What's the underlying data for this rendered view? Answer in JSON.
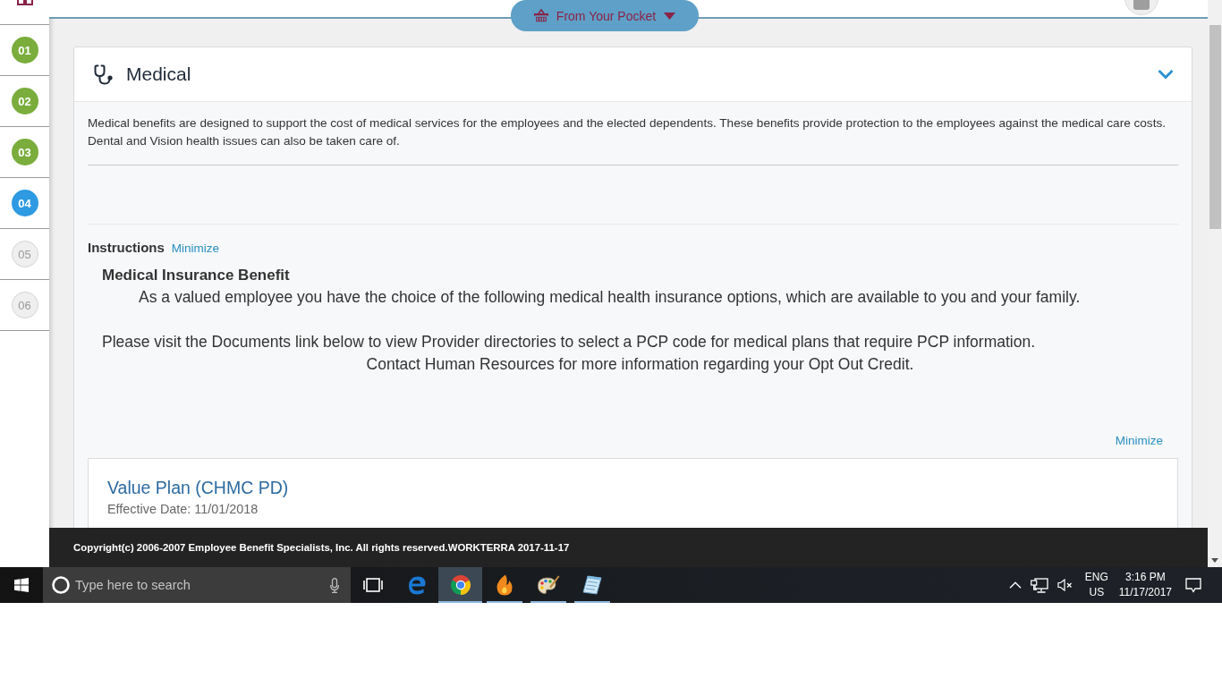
{
  "sidebar": {
    "steps": [
      {
        "label": "01",
        "completed": true,
        "selected": false
      },
      {
        "label": "02",
        "completed": true,
        "selected": false
      },
      {
        "label": "03",
        "completed": true,
        "selected": false
      },
      {
        "label": "04",
        "completed": false,
        "selected": true
      },
      {
        "label": "05",
        "completed": false,
        "selected": false
      },
      {
        "label": "06",
        "completed": false,
        "selected": false
      }
    ]
  },
  "header": {
    "pocket_menu": {
      "label": "From Your Pocket"
    }
  },
  "section": {
    "title": "Medical",
    "description": "Medical benefits are designed to support the cost of medical services for the employees and the elected dependents. These benefits provide protection to the employees against the medical care costs. Dental and Vision health issues can also be taken care of.",
    "instructions": {
      "label": "Instructions",
      "toggle": "Minimize",
      "heading": "Medical Insurance Benefit",
      "paragraphs": [
        {
          "kind": "indented",
          "text": "As a valued employee you have the choice of the following medical health insurance options, which are available to you and your family."
        },
        {
          "kind": "plain",
          "text": "Please visit the Documents link below to view Provider directories to select a PCP code for medical plans that require PCP information."
        },
        {
          "kind": "centered",
          "text": "Contact Human Resources for more information regarding your Opt Out Credit."
        }
      ],
      "bottom_toggle": "Minimize"
    },
    "plans": [
      {
        "name": "Value Plan (CHMC PD)",
        "effective_date": "Effective Date: 11/01/2018"
      }
    ]
  },
  "footer": {
    "text": "Copyright(c) 2006-2007 Employee Benefit Specialists, Inc. All rights reserved.WORKTERRA 2017-11-17"
  },
  "taskbar": {
    "search": {
      "placeholder": "Type here to search"
    },
    "apps": [
      {
        "kind": "edge",
        "running": false,
        "selected": false
      },
      {
        "kind": "chrome",
        "running": true,
        "selected": true
      },
      {
        "kind": "flame",
        "running": true,
        "selected": false
      },
      {
        "kind": "palette",
        "running": true,
        "selected": false
      },
      {
        "kind": "notepad",
        "running": true,
        "selected": false
      }
    ],
    "tray": {
      "muted": true,
      "language": "ENG",
      "region": "US",
      "time": "3:16 PM",
      "date": "11/17/2017"
    }
  }
}
